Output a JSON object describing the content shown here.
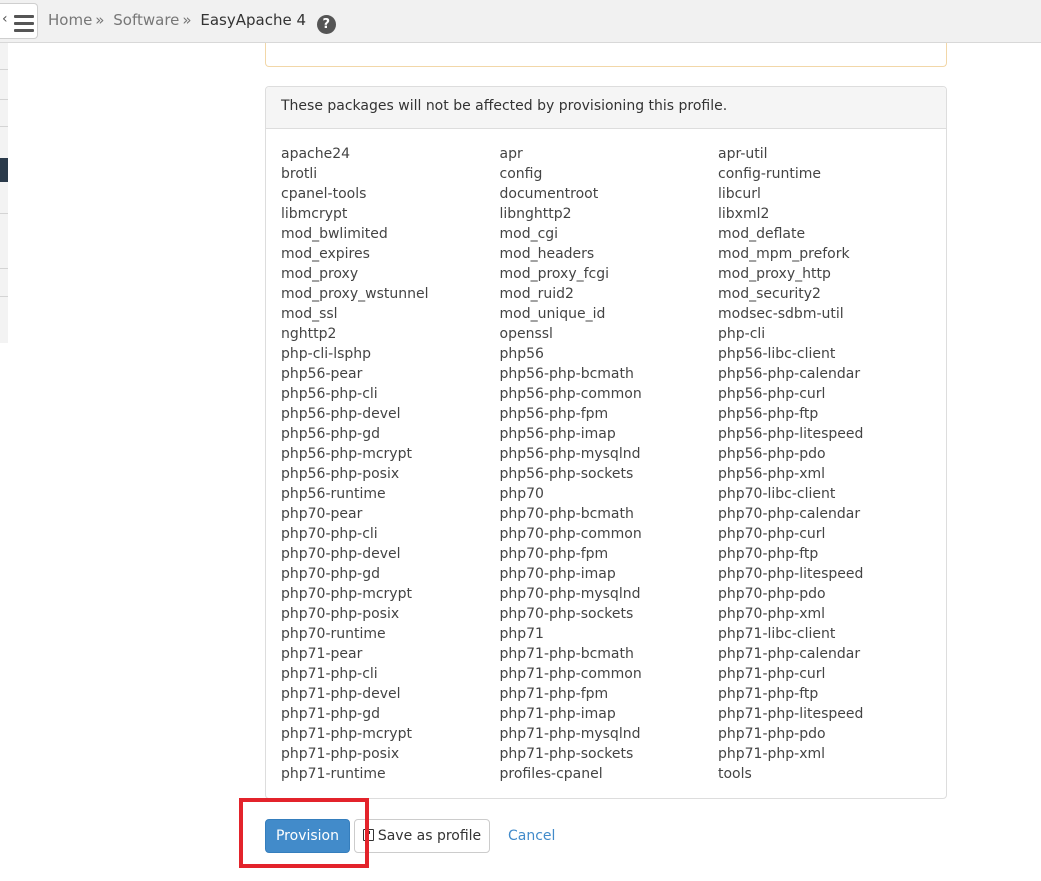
{
  "breadcrumb": {
    "home": "Home",
    "software": "Software",
    "current": "EasyApache 4",
    "separator": "»"
  },
  "panel": {
    "heading": "These packages will not be affected by provisioning this profile."
  },
  "packages": [
    "apache24",
    "apr",
    "apr-util",
    "brotli",
    "config",
    "config-runtime",
    "cpanel-tools",
    "documentroot",
    "libcurl",
    "libmcrypt",
    "libnghttp2",
    "libxml2",
    "mod_bwlimited",
    "mod_cgi",
    "mod_deflate",
    "mod_expires",
    "mod_headers",
    "mod_mpm_prefork",
    "mod_proxy",
    "mod_proxy_fcgi",
    "mod_proxy_http",
    "mod_proxy_wstunnel",
    "mod_ruid2",
    "mod_security2",
    "mod_ssl",
    "mod_unique_id",
    "modsec-sdbm-util",
    "nghttp2",
    "openssl",
    "php-cli",
    "php-cli-lsphp",
    "php56",
    "php56-libc-client",
    "php56-pear",
    "php56-php-bcmath",
    "php56-php-calendar",
    "php56-php-cli",
    "php56-php-common",
    "php56-php-curl",
    "php56-php-devel",
    "php56-php-fpm",
    "php56-php-ftp",
    "php56-php-gd",
    "php56-php-imap",
    "php56-php-litespeed",
    "php56-php-mcrypt",
    "php56-php-mysqlnd",
    "php56-php-pdo",
    "php56-php-posix",
    "php56-php-sockets",
    "php56-php-xml",
    "php56-runtime",
    "php70",
    "php70-libc-client",
    "php70-pear",
    "php70-php-bcmath",
    "php70-php-calendar",
    "php70-php-cli",
    "php70-php-common",
    "php70-php-curl",
    "php70-php-devel",
    "php70-php-fpm",
    "php70-php-ftp",
    "php70-php-gd",
    "php70-php-imap",
    "php70-php-litespeed",
    "php70-php-mcrypt",
    "php70-php-mysqlnd",
    "php70-php-pdo",
    "php70-php-posix",
    "php70-php-sockets",
    "php70-php-xml",
    "php70-runtime",
    "php71",
    "php71-libc-client",
    "php71-pear",
    "php71-php-bcmath",
    "php71-php-calendar",
    "php71-php-cli",
    "php71-php-common",
    "php71-php-curl",
    "php71-php-devel",
    "php71-php-fpm",
    "php71-php-ftp",
    "php71-php-gd",
    "php71-php-imap",
    "php71-php-litespeed",
    "php71-php-mcrypt",
    "php71-php-mysqlnd",
    "php71-php-pdo",
    "php71-php-posix",
    "php71-php-sockets",
    "php71-php-xml",
    "php71-runtime",
    "profiles-cpanel",
    "tools"
  ],
  "actions": {
    "provision": "Provision",
    "save_profile": "Save as profile",
    "cancel": "Cancel"
  },
  "colors": {
    "primary": "#428bca",
    "highlight": "#e3232b"
  }
}
